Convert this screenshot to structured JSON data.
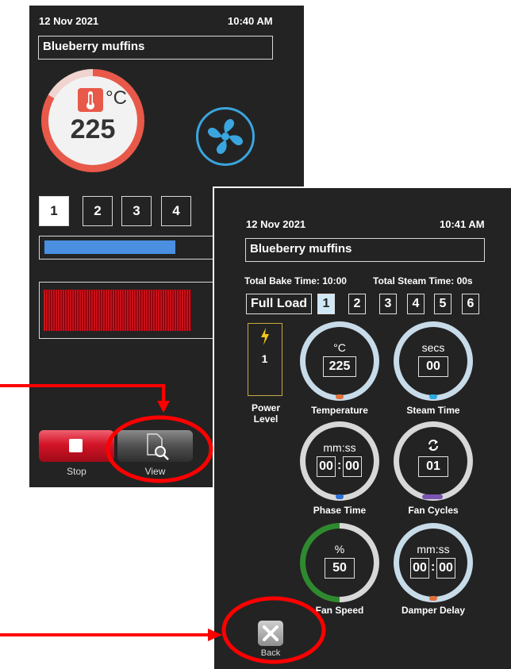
{
  "screen1": {
    "date": "12 Nov 2021",
    "time": "10:40 AM",
    "title": "Blueberry muffins",
    "temperature_unit": "°C",
    "temperature": "225",
    "steps": [
      "1",
      "2",
      "3",
      "4"
    ],
    "selected_step": "1",
    "stop_label": "Stop",
    "view_label": "View",
    "progress": 0.52
  },
  "screen2": {
    "date": "12 Nov 2021",
    "time": "10:41 AM",
    "title": "Blueberry muffins",
    "total_bake_time": "Total Bake Time: 10:00",
    "total_steam_time": "Total Steam Time: 00s",
    "full_load": "Full Load",
    "steps": [
      "1",
      "2",
      "3",
      "4",
      "5",
      "6"
    ],
    "selected_step": "1",
    "power_level_value": "1",
    "power_level_label": "Power Level",
    "temperature": {
      "unit": "°C",
      "value": "225",
      "label": "Temperature"
    },
    "steam_time": {
      "unit": "secs",
      "value": "00",
      "label": "Steam Time"
    },
    "phase_time": {
      "unit": "mm:ss",
      "min": "00",
      "sec": "00",
      "label": "Phase Time"
    },
    "fan_cycles": {
      "value": "01",
      "label": "Fan Cycles"
    },
    "fan_speed": {
      "unit": "%",
      "value": "50",
      "label": "Fan Speed",
      "level": 0.5
    },
    "damper_delay": {
      "unit": "mm:ss",
      "min": "00",
      "sec": "00",
      "label": "Damper Delay"
    },
    "back_label": "Back"
  },
  "colors": {
    "accent_blue": "#3aa5de",
    "alert_red": "#e8594a",
    "annotation_red": "#ff0000",
    "fan_speed_green": "#2f8a2f"
  },
  "icons": [
    "thermometer-icon",
    "fan-icon",
    "stop-icon",
    "view-icon",
    "lightning-icon",
    "refresh-icon",
    "close-icon"
  ]
}
